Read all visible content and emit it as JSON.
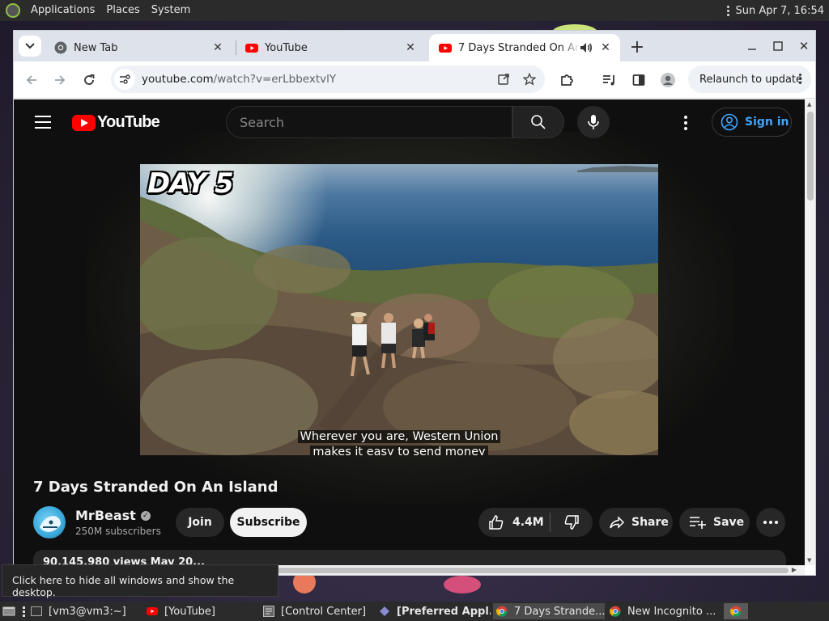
{
  "top_panel": {
    "menus": [
      "Applications",
      "Places",
      "System"
    ],
    "clock": "Sun Apr  7, 16:54"
  },
  "browser": {
    "tabs": [
      {
        "title": "New Tab",
        "icon": "chrome-icon",
        "active": false
      },
      {
        "title": "YouTube",
        "icon": "youtube-icon",
        "active": false
      },
      {
        "title": "7 Days Stranded On An Island",
        "icon": "youtube-icon",
        "active": true,
        "audio": true
      }
    ],
    "url_host": "youtube.com",
    "url_path": "/watch?v=erLbbextvlY",
    "relaunch_label": "Relaunch to update"
  },
  "youtube": {
    "logo_text": "YouTube",
    "search_placeholder": "Search",
    "signin_label": "Sign in",
    "video": {
      "overlay_text": "DAY 5",
      "caption_line1": "Wherever you are, Western Union",
      "caption_line2": "makes it easy to send money"
    },
    "title": "7 Days Stranded On An Island",
    "channel": {
      "name": "MrBeast",
      "subscribers": "250M subscribers",
      "verified": true
    },
    "actions": {
      "join": "Join",
      "subscribe": "Subscribe",
      "likes": "4.4M",
      "share": "Share",
      "save": "Save"
    },
    "description_preview": "90,145,980 views  May 20..."
  },
  "tooltip": "Click here to hide all windows and show the desktop.",
  "taskbar": {
    "items": [
      {
        "label": "[vm3@vm3:~]",
        "icon": "terminal-icon"
      },
      {
        "label": "[YouTube]",
        "icon": "youtube-icon"
      },
      {
        "label": "[Control Center]",
        "icon": "control-center-icon"
      },
      {
        "label": "[Preferred Appl...",
        "icon": "preferences-icon"
      },
      {
        "label": "7 Days Strande...",
        "icon": "chrome-icon"
      },
      {
        "label": "New Incognito ...",
        "icon": "chrome-icon"
      }
    ]
  },
  "colors": {
    "youtube_red": "#ff0000",
    "signin_blue": "#3ea6ff",
    "yt_background": "#0f0f0f"
  }
}
